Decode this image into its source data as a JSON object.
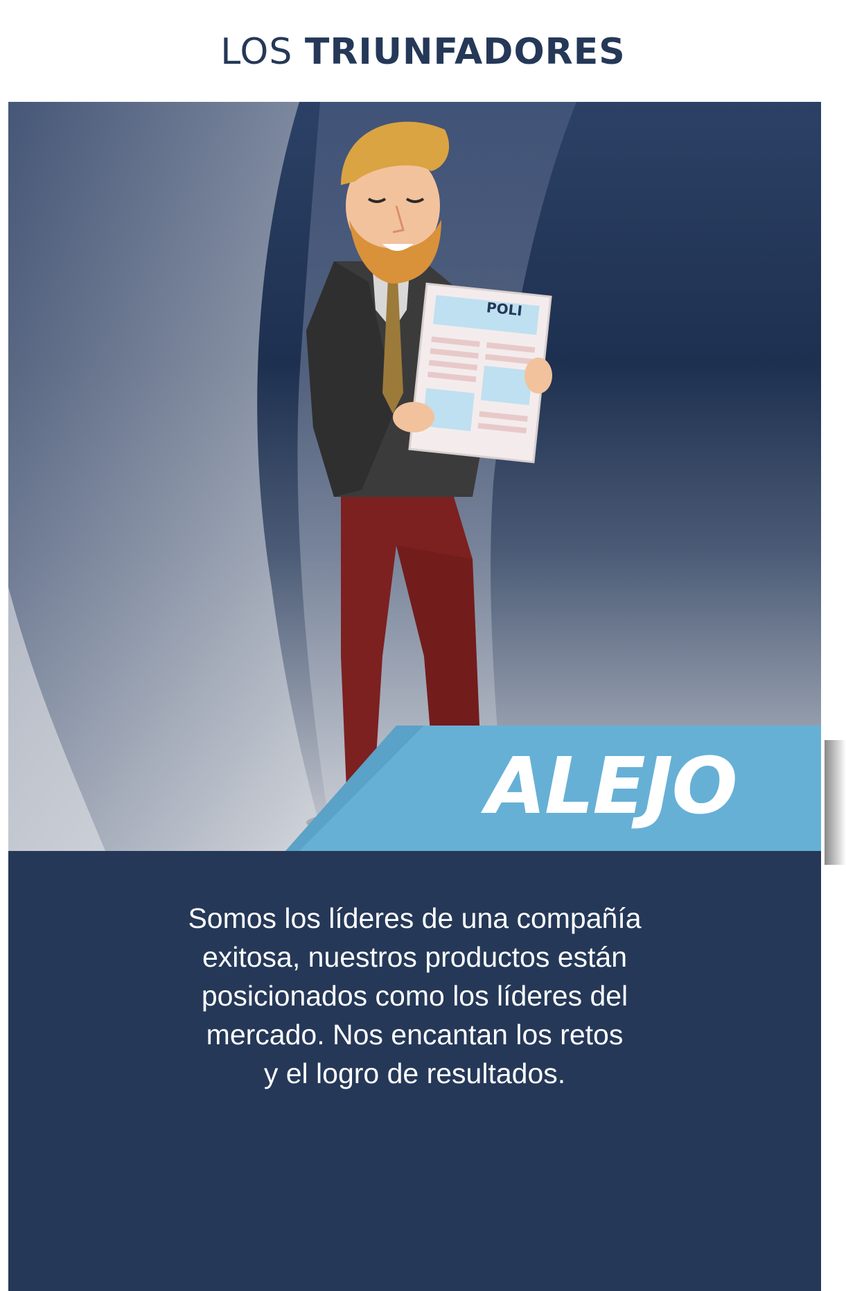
{
  "header": {
    "title_light": "LOS",
    "title_bold": "TRIUNFADORES"
  },
  "card": {
    "name": "ALEJO",
    "illustration_label": "POLI",
    "description_lines": [
      "Somos los líderes de una compañía",
      "exitosa, nuestros productos están",
      "posicionados como los líderes del",
      "mercado. Nos encantan los retos",
      "y el logro de resultados."
    ]
  },
  "colors": {
    "navy": "#253858",
    "banner_blue": "#66b0d6",
    "text_white": "#ffffff",
    "pants": "#7d2020",
    "jacket": "#3a3a3a",
    "hair": "#d9a441"
  }
}
